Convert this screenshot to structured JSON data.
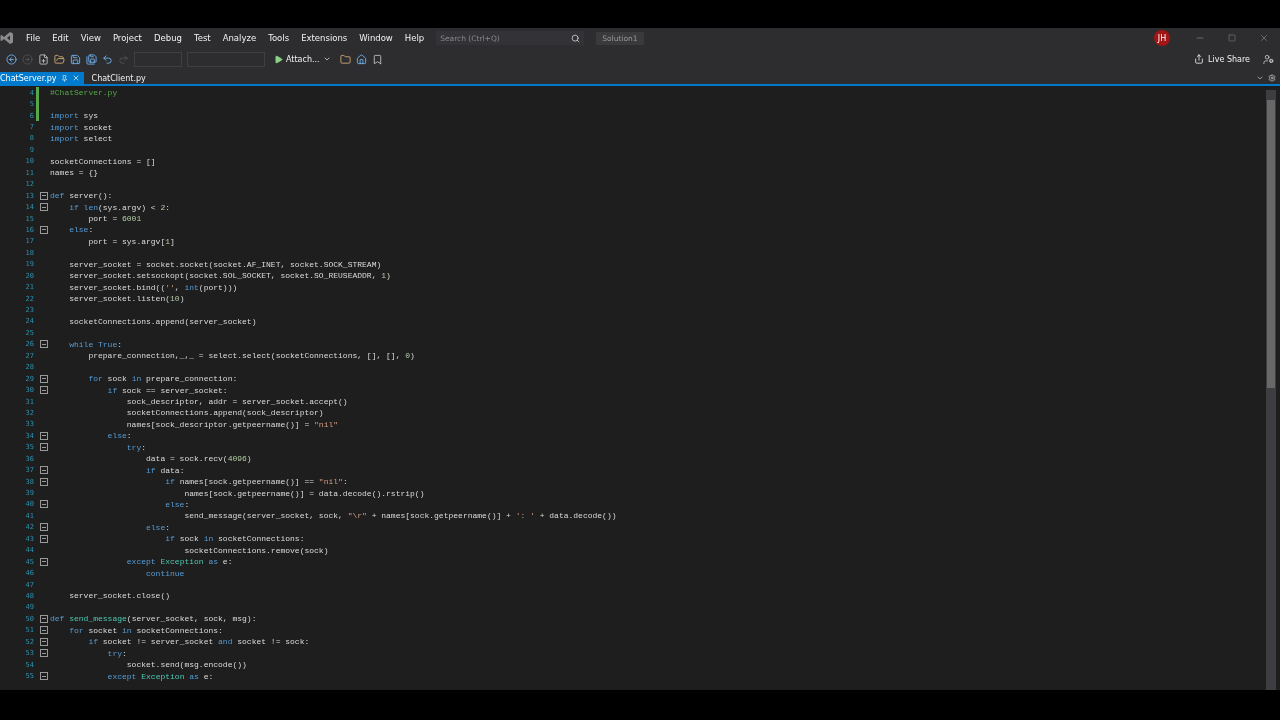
{
  "menu": [
    "File",
    "Edit",
    "View",
    "Project",
    "Debug",
    "Test",
    "Analyze",
    "Tools",
    "Extensions",
    "Window",
    "Help"
  ],
  "search": {
    "placeholder": "Search (Ctrl+Q)"
  },
  "solution": "Solution1",
  "account": {
    "initials": "JH"
  },
  "toolbar": {
    "attach": "Attach...",
    "live_share": "Live Share"
  },
  "tabs": [
    {
      "label": "ChatServer.py",
      "selected": true
    },
    {
      "label": "ChatClient.py",
      "selected": false
    }
  ],
  "lines": [
    {
      "n": "4",
      "fold": false,
      "changed": true,
      "segs": [
        {
          "kind": "cmt",
          "text": "#ChatServer.py"
        }
      ]
    },
    {
      "n": "5",
      "fold": false,
      "changed": true
    },
    {
      "n": "6",
      "fold": false,
      "changed": true,
      "segs": [
        {
          "kind": "kw",
          "text": "import"
        },
        {
          "kind": "plain",
          "text": " sys"
        }
      ]
    },
    {
      "n": "7",
      "fold": false,
      "changed": false,
      "segs": [
        {
          "kind": "kw",
          "text": "import"
        },
        {
          "kind": "plain",
          "text": " socket"
        }
      ]
    },
    {
      "n": "8",
      "fold": false,
      "changed": false,
      "segs": [
        {
          "kind": "kw",
          "text": "import"
        },
        {
          "kind": "plain",
          "text": " select"
        }
      ]
    },
    {
      "n": "9",
      "fold": false,
      "changed": false
    },
    {
      "n": "10",
      "fold": false,
      "changed": false,
      "segs": [
        {
          "kind": "plain",
          "text": "socketConnections = []"
        }
      ]
    },
    {
      "n": "11",
      "fold": false,
      "changed": false,
      "segs": [
        {
          "kind": "plain",
          "text": "names = {}"
        }
      ]
    },
    {
      "n": "12",
      "fold": false,
      "changed": false
    },
    {
      "n": "13",
      "fold": true,
      "changed": false,
      "segs": [
        {
          "kind": "kw",
          "text": "def"
        },
        {
          "kind": "plain",
          "text": " server():"
        }
      ]
    },
    {
      "n": "14",
      "fold": true,
      "changed": false,
      "segs": [
        {
          "kind": "kw",
          "text": "    if len"
        },
        {
          "kind": "plain",
          "text": "(sys.argv) < "
        },
        {
          "kind": "num",
          "text": "2"
        },
        {
          "kind": "plain",
          "text": ":"
        }
      ]
    },
    {
      "n": "15",
      "fold": false,
      "changed": false,
      "segs": [
        {
          "kind": "plain",
          "text": "        port = "
        },
        {
          "kind": "num",
          "text": "6001"
        }
      ]
    },
    {
      "n": "16",
      "fold": true,
      "changed": false,
      "segs": [
        {
          "kind": "kw",
          "text": "    else"
        },
        {
          "kind": "plain",
          "text": ":"
        }
      ]
    },
    {
      "n": "17",
      "fold": false,
      "changed": false,
      "segs": [
        {
          "kind": "plain",
          "text": "        port = sys.argv["
        },
        {
          "kind": "num",
          "text": "1"
        },
        {
          "kind": "plain",
          "text": "]"
        }
      ]
    },
    {
      "n": "18",
      "fold": false,
      "changed": false
    },
    {
      "n": "19",
      "fold": false,
      "changed": false,
      "segs": [
        {
          "kind": "plain",
          "text": "    server_socket = socket.socket(socket.AF_INET, socket.SOCK_STREAM)"
        }
      ]
    },
    {
      "n": "20",
      "fold": false,
      "changed": false,
      "segs": [
        {
          "kind": "plain",
          "text": "    server_socket.setsockopt(socket.SOL_SOCKET, socket.SO_REUSEADDR, "
        },
        {
          "kind": "num",
          "text": "1"
        },
        {
          "kind": "plain",
          "text": ")"
        }
      ]
    },
    {
      "n": "21",
      "fold": false,
      "changed": false,
      "segs": [
        {
          "kind": "plain",
          "text": "    server_socket.bind(("
        },
        {
          "kind": "str",
          "text": "''"
        },
        {
          "kind": "plain",
          "text": ", "
        },
        {
          "kind": "kw",
          "text": "int"
        },
        {
          "kind": "plain",
          "text": "(port)))"
        }
      ]
    },
    {
      "n": "22",
      "fold": false,
      "changed": false,
      "segs": [
        {
          "kind": "plain",
          "text": "    server_socket.listen("
        },
        {
          "kind": "num",
          "text": "10"
        },
        {
          "kind": "plain",
          "text": ")"
        }
      ]
    },
    {
      "n": "23",
      "fold": false,
      "changed": false
    },
    {
      "n": "24",
      "fold": false,
      "changed": false,
      "segs": [
        {
          "kind": "plain",
          "text": "    socketConnections.append(server_socket)"
        }
      ]
    },
    {
      "n": "25",
      "fold": false,
      "changed": false
    },
    {
      "n": "26",
      "fold": true,
      "changed": false,
      "segs": [
        {
          "kind": "kw",
          "text": "    while True"
        },
        {
          "kind": "plain",
          "text": ":"
        }
      ]
    },
    {
      "n": "27",
      "fold": false,
      "changed": false,
      "segs": [
        {
          "kind": "plain",
          "text": "        prepare_connection,_,_ = select.select(socketConnections, [], [], "
        },
        {
          "kind": "num",
          "text": "0"
        },
        {
          "kind": "plain",
          "text": ")"
        }
      ]
    },
    {
      "n": "28",
      "fold": false,
      "changed": false
    },
    {
      "n": "29",
      "fold": true,
      "changed": false,
      "segs": [
        {
          "kind": "kw",
          "text": "        for"
        },
        {
          "kind": "plain",
          "text": " sock "
        },
        {
          "kind": "kw",
          "text": "in"
        },
        {
          "kind": "plain",
          "text": " prepare_connection:"
        }
      ]
    },
    {
      "n": "30",
      "fold": true,
      "changed": false,
      "segs": [
        {
          "kind": "kw",
          "text": "            if"
        },
        {
          "kind": "plain",
          "text": " sock == server_socket:"
        }
      ]
    },
    {
      "n": "31",
      "fold": false,
      "changed": false,
      "segs": [
        {
          "kind": "plain",
          "text": "                sock_descriptor, addr = server_socket.accept()"
        }
      ]
    },
    {
      "n": "32",
      "fold": false,
      "changed": false,
      "segs": [
        {
          "kind": "plain",
          "text": "                socketConnections.append(sock_descriptor)"
        }
      ]
    },
    {
      "n": "33",
      "fold": false,
      "changed": false,
      "segs": [
        {
          "kind": "plain",
          "text": "                names[sock_descriptor.getpeername()] = "
        },
        {
          "kind": "str",
          "text": "\"nil\""
        }
      ]
    },
    {
      "n": "34",
      "fold": true,
      "changed": false,
      "segs": [
        {
          "kind": "kw",
          "text": "            else"
        },
        {
          "kind": "plain",
          "text": ":"
        }
      ]
    },
    {
      "n": "35",
      "fold": true,
      "changed": false,
      "segs": [
        {
          "kind": "kw",
          "text": "                try"
        },
        {
          "kind": "plain",
          "text": ":"
        }
      ]
    },
    {
      "n": "36",
      "fold": false,
      "changed": false,
      "segs": [
        {
          "kind": "plain",
          "text": "                    data = sock.recv("
        },
        {
          "kind": "num",
          "text": "4096"
        },
        {
          "kind": "plain",
          "text": ")"
        }
      ]
    },
    {
      "n": "37",
      "fold": true,
      "changed": false,
      "segs": [
        {
          "kind": "kw",
          "text": "                    if"
        },
        {
          "kind": "plain",
          "text": " data:"
        }
      ]
    },
    {
      "n": "38",
      "fold": true,
      "changed": false,
      "segs": [
        {
          "kind": "kw",
          "text": "                        if"
        },
        {
          "kind": "plain",
          "text": " names[sock.getpeername()] == "
        },
        {
          "kind": "str",
          "text": "\"nil\""
        },
        {
          "kind": "plain",
          "text": ":"
        }
      ]
    },
    {
      "n": "39",
      "fold": false,
      "changed": false,
      "segs": [
        {
          "kind": "plain",
          "text": "                            names[sock.getpeername()] = data.decode().rstrip()"
        }
      ]
    },
    {
      "n": "40",
      "fold": true,
      "changed": false,
      "segs": [
        {
          "kind": "kw",
          "text": "                        else"
        },
        {
          "kind": "plain",
          "text": ":"
        }
      ]
    },
    {
      "n": "41",
      "fold": false,
      "changed": false,
      "segs": [
        {
          "kind": "plain",
          "text": "                            send_message(server_socket, sock, "
        },
        {
          "kind": "str",
          "text": "\"\\r\""
        },
        {
          "kind": "plain",
          "text": " + names[sock.getpeername()] + "
        },
        {
          "kind": "str",
          "text": "': '"
        },
        {
          "kind": "plain",
          "text": " + data.decode())"
        }
      ]
    },
    {
      "n": "42",
      "fold": true,
      "changed": false,
      "segs": [
        {
          "kind": "kw",
          "text": "                    else"
        },
        {
          "kind": "plain",
          "text": ":"
        }
      ]
    },
    {
      "n": "43",
      "fold": true,
      "changed": false,
      "segs": [
        {
          "kind": "kw",
          "text": "                        if"
        },
        {
          "kind": "plain",
          "text": " sock "
        },
        {
          "kind": "kw",
          "text": "in"
        },
        {
          "kind": "plain",
          "text": " socketConnections:"
        }
      ]
    },
    {
      "n": "44",
      "fold": false,
      "changed": false,
      "segs": [
        {
          "kind": "plain",
          "text": "                            socketConnections.remove(sock)"
        }
      ]
    },
    {
      "n": "45",
      "fold": true,
      "changed": false,
      "segs": [
        {
          "kind": "kw",
          "text": "                except"
        },
        {
          "kind": "type",
          "text": " Exception"
        },
        {
          "kind": "kw",
          "text": " as"
        },
        {
          "kind": "plain",
          "text": " e:"
        }
      ]
    },
    {
      "n": "46",
      "fold": false,
      "changed": false,
      "segs": [
        {
          "kind": "kw",
          "text": "                    continue"
        }
      ]
    },
    {
      "n": "47",
      "fold": false,
      "changed": false
    },
    {
      "n": "48",
      "fold": false,
      "changed": false,
      "segs": [
        {
          "kind": "plain",
          "text": "    server_socket.close()"
        }
      ]
    },
    {
      "n": "49",
      "fold": false,
      "changed": false
    },
    {
      "n": "50",
      "fold": true,
      "changed": false,
      "segs": [
        {
          "kind": "kw",
          "text": "def"
        },
        {
          "kind": "fn",
          "text": " send_message"
        },
        {
          "kind": "plain",
          "text": "(server_socket, sock, msg):"
        }
      ]
    },
    {
      "n": "51",
      "fold": true,
      "changed": false,
      "segs": [
        {
          "kind": "kw",
          "text": "    for"
        },
        {
          "kind": "plain",
          "text": " socket "
        },
        {
          "kind": "kw",
          "text": "in"
        },
        {
          "kind": "plain",
          "text": " socketConnections:"
        }
      ]
    },
    {
      "n": "52",
      "fold": true,
      "changed": false,
      "segs": [
        {
          "kind": "kw",
          "text": "        if"
        },
        {
          "kind": "plain",
          "text": " socket != server_socket "
        },
        {
          "kind": "kw",
          "text": "and"
        },
        {
          "kind": "plain",
          "text": " socket != sock:"
        }
      ]
    },
    {
      "n": "53",
      "fold": true,
      "changed": false,
      "segs": [
        {
          "kind": "kw",
          "text": "            try"
        },
        {
          "kind": "plain",
          "text": ":"
        }
      ]
    },
    {
      "n": "54",
      "fold": false,
      "changed": false,
      "segs": [
        {
          "kind": "plain",
          "text": "                socket.send(msg.encode())"
        }
      ]
    },
    {
      "n": "55",
      "fold": true,
      "changed": false,
      "segs": [
        {
          "kind": "kw",
          "text": "            except"
        },
        {
          "kind": "type",
          "text": " Exception"
        },
        {
          "kind": "kw",
          "text": " as"
        },
        {
          "kind": "plain",
          "text": " e:"
        }
      ]
    }
  ]
}
